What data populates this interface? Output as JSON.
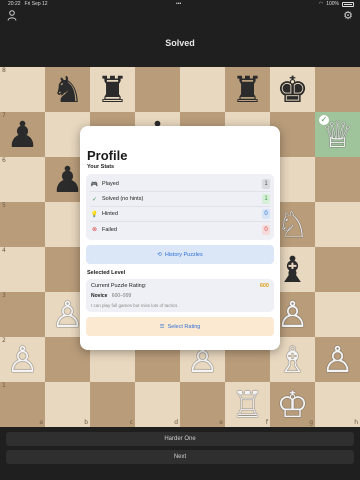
{
  "status": {
    "time": "20:22",
    "date": "Fri Sep 12",
    "battery": "100%"
  },
  "nav": {
    "title": "Solved",
    "left_icon": "person-icon",
    "right_icon": "gear-icon"
  },
  "board": {
    "ranks": [
      "8",
      "7",
      "6",
      "5",
      "4",
      "3",
      "2",
      "1"
    ],
    "files": [
      "a",
      "b",
      "c",
      "d",
      "e",
      "f",
      "g",
      "h"
    ],
    "pieces": [
      [
        "",
        "♞b",
        "♜b",
        "",
        "",
        "♜b",
        "♚b",
        ""
      ],
      [
        "♟b",
        "",
        "",
        "♟b",
        "",
        "",
        "",
        "♕w"
      ],
      [
        "",
        "♟b",
        "",
        "",
        "",
        "",
        "",
        ""
      ],
      [
        "",
        "",
        "",
        "",
        "",
        "",
        "♘w",
        ""
      ],
      [
        "",
        "",
        "",
        "",
        "",
        "",
        "♝b",
        ""
      ],
      [
        "",
        "♙w",
        "",
        "",
        "",
        "",
        "♙w",
        ""
      ],
      [
        "♙w",
        "",
        "",
        "",
        "♙w",
        "",
        "♗w",
        "♙w"
      ],
      [
        "",
        "",
        "",
        "",
        "",
        "♖w",
        "♔w",
        ""
      ]
    ],
    "highlight": "h7"
  },
  "profile": {
    "title": "Profile",
    "stats_label": "Your Stats",
    "stats": [
      {
        "icon": "gamepad-icon",
        "label": "Played",
        "count": "1",
        "color": "#555555",
        "bg": "#d9dbe0"
      },
      {
        "icon": "check-circle-icon",
        "label": "Solved (no hints)",
        "count": "1",
        "color": "#3a9a4a",
        "bg": "#d6efd9"
      },
      {
        "icon": "lightbulb-icon",
        "label": "Hinted",
        "count": "0",
        "color": "#2f6fd6",
        "bg": "#d6e4f7"
      },
      {
        "icon": "x-circle-icon",
        "label": "Failed",
        "count": "0",
        "color": "#d94040",
        "bg": "#f7dada"
      }
    ],
    "history_button": "History Puzzles",
    "selected_level_label": "Selected Level",
    "rating_label": "Current Puzzle Rating:",
    "rating_value": "600",
    "level_name": "Novice",
    "level_range": "600–999",
    "level_desc": "I can play full games but miss lots of tactics.",
    "select_button": "Select Rating"
  },
  "buttons": {
    "harder": "Harder One",
    "next": "Next"
  }
}
